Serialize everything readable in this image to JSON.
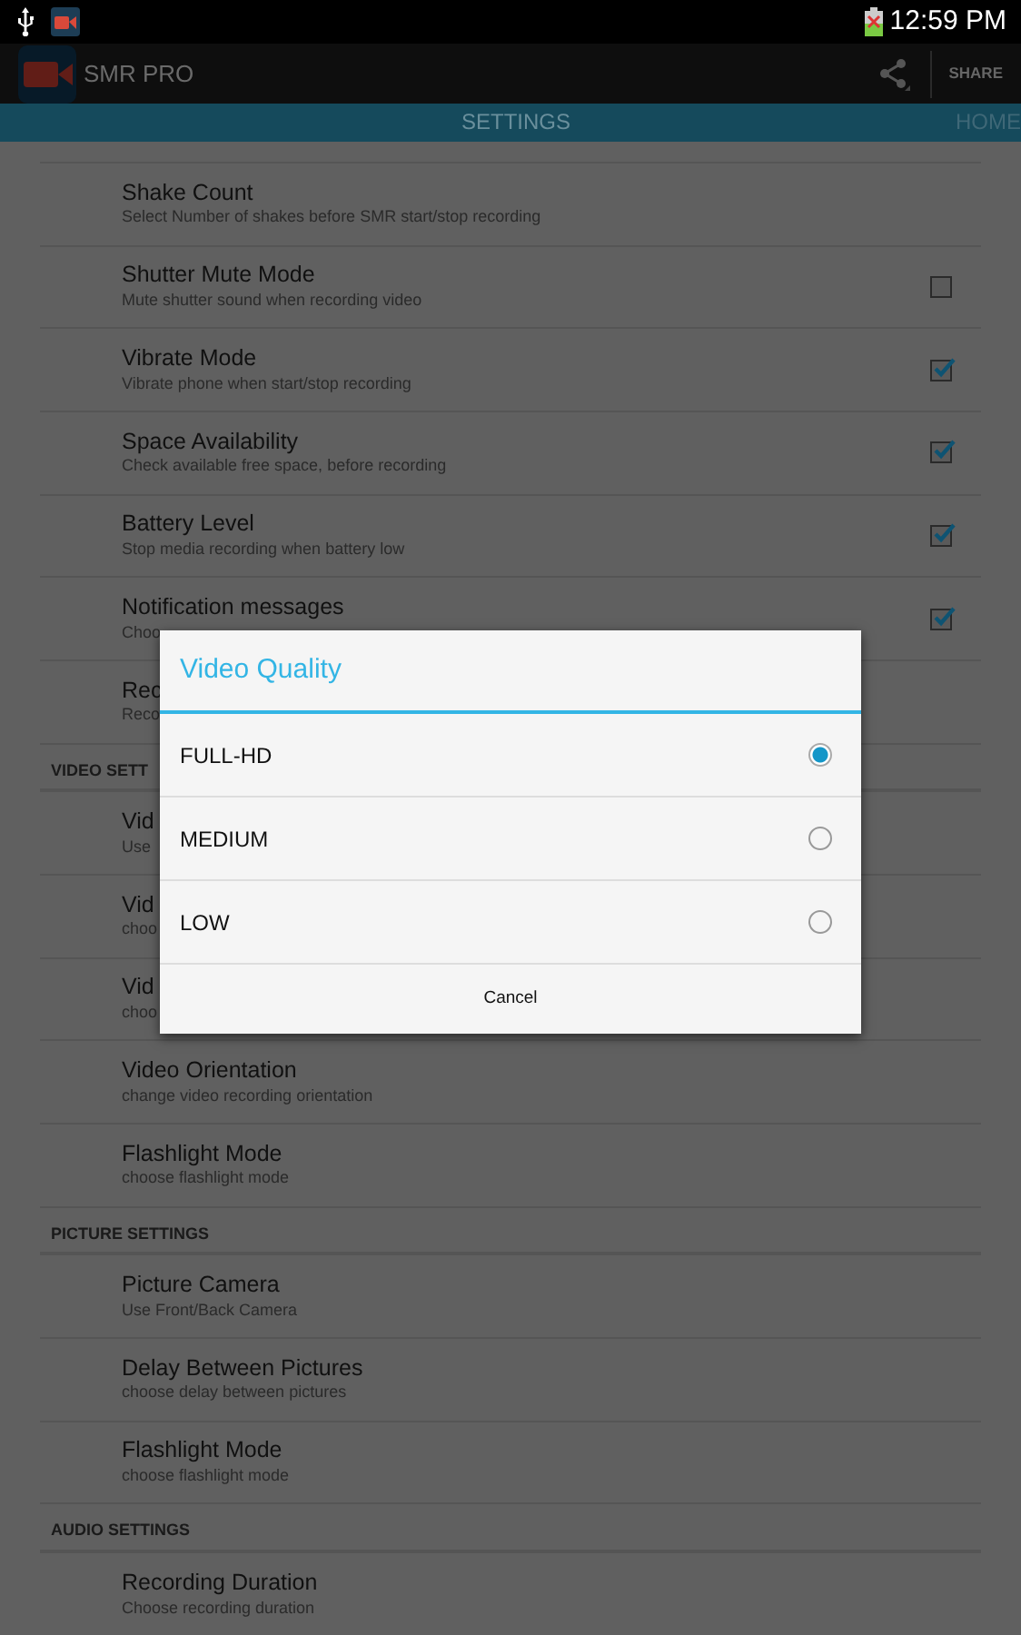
{
  "status_bar": {
    "time": "12:59 PM"
  },
  "action_bar": {
    "title": "SMR PRO",
    "action": "SHARE"
  },
  "tabs": [
    {
      "label": "SETTINGS",
      "selected": true
    },
    {
      "label": "HOME",
      "selected": false
    }
  ],
  "sections": [
    {
      "rows": [
        {
          "kind": "plain",
          "title": "Shake Count",
          "subtitle": "Select Number of shakes before SMR start/stop recording"
        },
        {
          "kind": "checkbox",
          "title": "Shutter Mute Mode",
          "subtitle": "Mute shutter sound when recording video",
          "checked": false
        },
        {
          "kind": "checkbox",
          "title": "Vibrate Mode",
          "subtitle": "Vibrate phone when start/stop recording",
          "checked": true
        },
        {
          "kind": "checkbox",
          "title": "Space Availability",
          "subtitle": "Check available free space, before recording",
          "checked": true
        },
        {
          "kind": "checkbox",
          "title": "Battery Level",
          "subtitle": "Stop media recording when battery low",
          "checked": true
        },
        {
          "kind": "checkbox",
          "title": "Notification messages",
          "subtitle": "Choo",
          "checked": true
        },
        {
          "kind": "plain",
          "title": "Rec",
          "subtitle": "Reco"
        }
      ]
    },
    {
      "header": "VIDEO SETT",
      "rows": [
        {
          "kind": "plain",
          "title": "Vid",
          "subtitle": "Use"
        },
        {
          "kind": "plain",
          "title": "Vid",
          "subtitle": "choo"
        },
        {
          "kind": "plain",
          "title": "Vid",
          "subtitle": "choo"
        },
        {
          "kind": "plain",
          "title": "Video Orientation",
          "subtitle": "change video recording orientation"
        },
        {
          "kind": "plain",
          "title": "Flashlight Mode",
          "subtitle": "choose flashlight mode"
        }
      ]
    },
    {
      "header": "PICTURE SETTINGS",
      "rows": [
        {
          "kind": "plain",
          "title": "Picture Camera",
          "subtitle": "Use Front/Back Camera"
        },
        {
          "kind": "plain",
          "title": "Delay Between Pictures",
          "subtitle": "choose delay between pictures"
        },
        {
          "kind": "plain",
          "title": "Flashlight Mode",
          "subtitle": "choose flashlight mode"
        }
      ]
    },
    {
      "header": "AUDIO SETTINGS",
      "rows": [
        {
          "kind": "plain",
          "title": "Recording Duration",
          "subtitle": "Choose recording duration"
        }
      ]
    }
  ],
  "dialog": {
    "title": "Video Quality",
    "options": [
      {
        "label": "FULL-HD",
        "selected": true
      },
      {
        "label": "MEDIUM",
        "selected": false
      },
      {
        "label": "LOW",
        "selected": false
      }
    ],
    "cancel": "Cancel"
  }
}
